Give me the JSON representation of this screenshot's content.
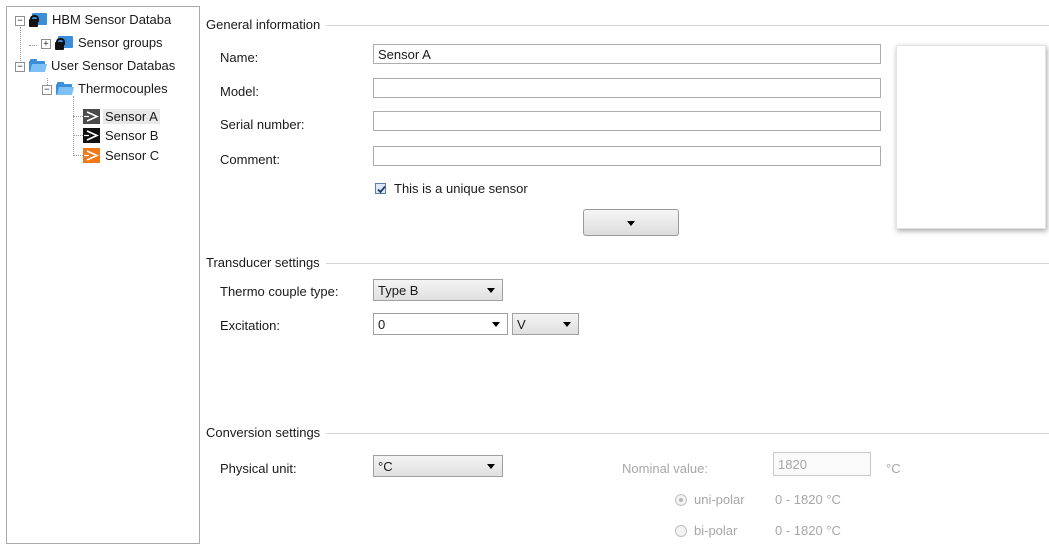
{
  "tree": {
    "root1": "HBM Sensor Databa",
    "root1_child": "Sensor groups",
    "root2": "User Sensor Databas",
    "folder": "Thermocouples",
    "sensors": [
      "Sensor A",
      "Sensor B",
      "Sensor C"
    ],
    "sensor_colors": [
      "#4a4a4a",
      "#111111",
      "#f07818"
    ]
  },
  "general": {
    "title": "General information",
    "name_label": "Name:",
    "name_value": "Sensor A",
    "model_label": "Model:",
    "model_value": "",
    "serial_label": "Serial number:",
    "serial_value": "",
    "comment_label": "Comment:",
    "comment_value": "",
    "unique_label": "This is a unique sensor",
    "unique_checked": true
  },
  "transducer": {
    "title": "Transducer settings",
    "type_label": "Thermo couple type:",
    "type_value": "Type B",
    "excitation_label": "Excitation:",
    "excitation_value": "0",
    "excitation_unit": "V"
  },
  "conversion": {
    "title": "Conversion settings",
    "unit_label": "Physical unit:",
    "unit_value": "°C",
    "nominal_label": "Nominal value:",
    "nominal_value": "1820",
    "nominal_unit": "°C",
    "unipolar_label": "uni-polar",
    "unipolar_range": "0 - 1820 °C",
    "bipolar_label": "bi-polar",
    "bipolar_range": "0 - 1820 °C"
  }
}
